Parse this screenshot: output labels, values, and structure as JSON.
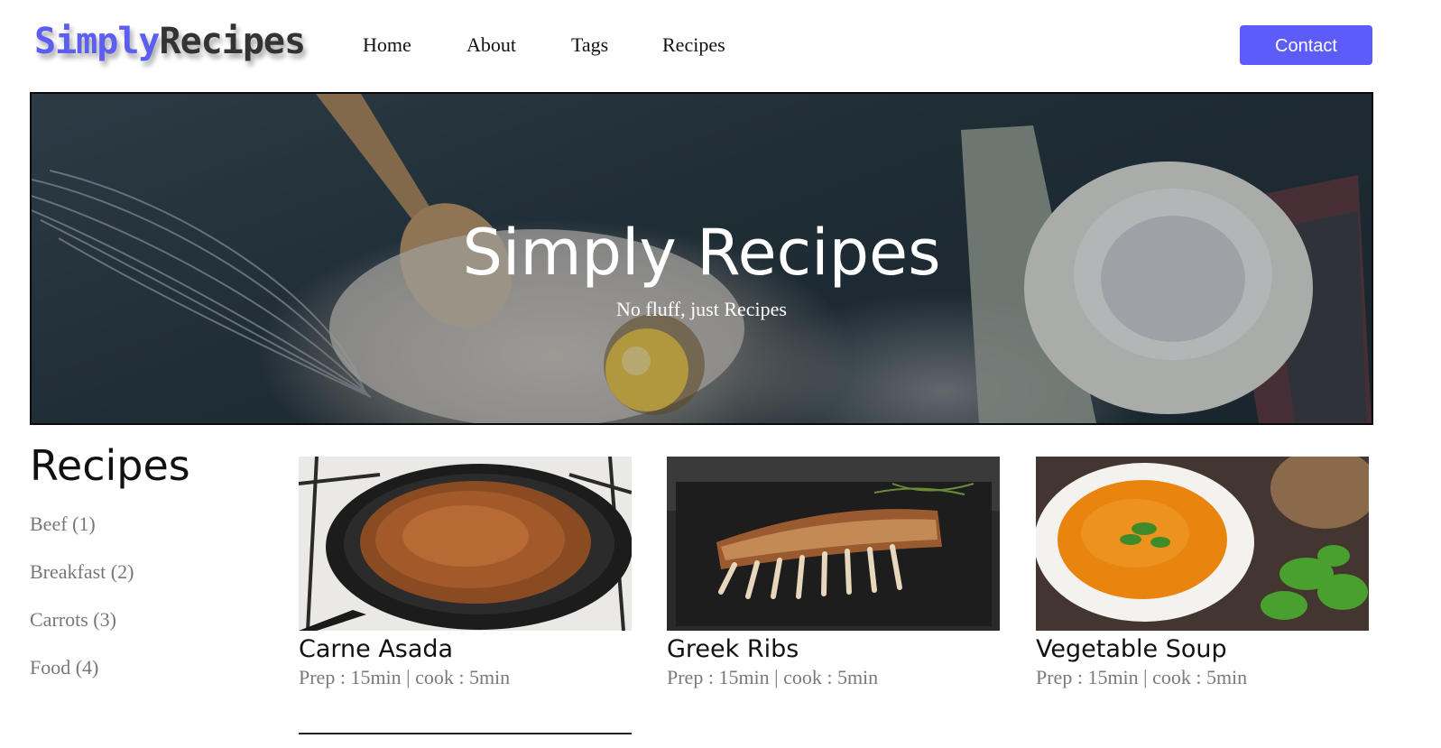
{
  "brand": {
    "part1": "Simply",
    "part2": "Recipes"
  },
  "nav": {
    "items": [
      {
        "label": "Home"
      },
      {
        "label": "About"
      },
      {
        "label": "Tags"
      },
      {
        "label": "Recipes"
      }
    ],
    "contact_label": "Contact"
  },
  "hero": {
    "title": "Simply Recipes",
    "subtitle": "No fluff, just Recipes"
  },
  "sidebar": {
    "title": "Recipes",
    "tags": [
      {
        "label": "Beef (1)"
      },
      {
        "label": "Breakfast (2)"
      },
      {
        "label": "Carrots (3)"
      },
      {
        "label": "Food (4)"
      }
    ]
  },
  "recipes": [
    {
      "title": "Carne Asada",
      "meta": "Prep : 15min | cook : 5min",
      "image_icon": "frying-pan-ground-meat"
    },
    {
      "title": "Greek Ribs",
      "meta": "Prep : 15min | cook : 5min",
      "image_icon": "grilled-ribs"
    },
    {
      "title": "Vegetable Soup",
      "meta": "Prep : 15min | cook : 5min",
      "image_icon": "soup-bowl"
    }
  ],
  "colors": {
    "accent": "#5c5cfa",
    "text": "#111111",
    "muted": "#777777"
  }
}
